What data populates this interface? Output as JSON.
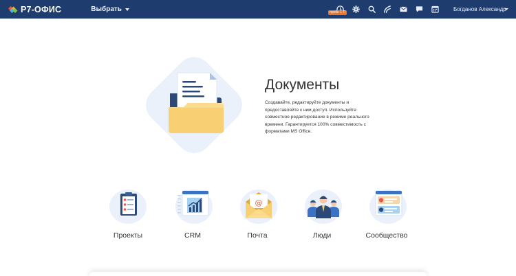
{
  "header": {
    "logo_text": "Р7-ОФИС",
    "select_label": "Выбрать",
    "trial_badge": "пробн 1 П",
    "user_name": "Богданов Александр",
    "icons": [
      "trial-clock-icon",
      "settings-icon",
      "search-icon",
      "feed-icon",
      "mail-icon",
      "chat-icon",
      "calendar-icon"
    ],
    "colors": {
      "bar": "#1f3c6e",
      "badge": "#e8752c"
    }
  },
  "hero": {
    "title": "Документы",
    "description": "Создавайте, редактируйте документы и предоставляйте к ним доступ. Используйте совместное редактирование в режиме реального времени. Гарантируется 100% совместимость с форматами MS Office."
  },
  "modules": [
    {
      "id": "projects",
      "label": "Проекты",
      "icon": "projects-clipboard-icon"
    },
    {
      "id": "crm",
      "label": "CRM",
      "icon": "crm-chart-icon"
    },
    {
      "id": "mail",
      "label": "Почта",
      "icon": "mail-envelope-icon"
    },
    {
      "id": "people",
      "label": "Люди",
      "icon": "people-group-icon"
    },
    {
      "id": "community",
      "label": "Сообщество",
      "icon": "community-profiles-icon"
    }
  ]
}
